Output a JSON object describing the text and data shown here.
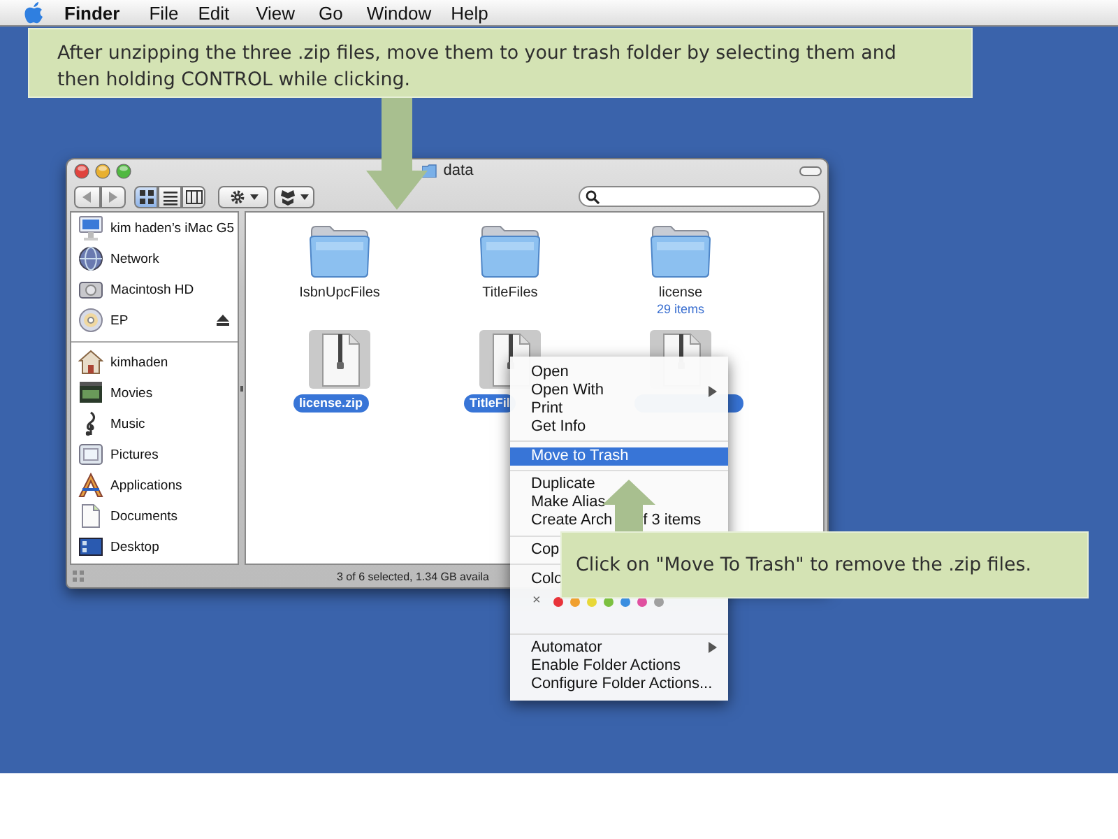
{
  "menubar": {
    "items": [
      {
        "label": "Finder",
        "kind": "app"
      },
      {
        "label": "File",
        "kind": "menu"
      },
      {
        "label": "Edit",
        "kind": "menu"
      },
      {
        "label": "View",
        "kind": "menu"
      },
      {
        "label": "Go",
        "kind": "menu"
      },
      {
        "label": "Window",
        "kind": "menu"
      },
      {
        "label": "Help",
        "kind": "menu"
      }
    ]
  },
  "instruction_top": {
    "text": "After unzipping the three .zip files, move them to your trash folder by selecting them and then holding CONTROL while clicking."
  },
  "window": {
    "title": "data",
    "view_modes": [
      {
        "kind": "icon",
        "selected": true
      },
      {
        "kind": "list",
        "selected": false
      },
      {
        "kind": "columns",
        "selected": false
      }
    ],
    "sidebar": {
      "devices": [
        {
          "label": "kim haden’s iMac G5",
          "ejectable": false
        },
        {
          "label": "Network",
          "ejectable": false
        },
        {
          "label": "Macintosh HD",
          "ejectable": false
        },
        {
          "label": "EP",
          "ejectable": true
        }
      ],
      "places": [
        {
          "label": "kimhaden"
        },
        {
          "label": "Movies"
        },
        {
          "label": "Music"
        },
        {
          "label": "Pictures"
        },
        {
          "label": "Applications"
        },
        {
          "label": "Documents"
        },
        {
          "label": "Desktop"
        }
      ]
    },
    "files": [
      {
        "kind": "folder",
        "name": "IsbnUpcFiles",
        "selected": false
      },
      {
        "kind": "folder",
        "name": "TitleFiles",
        "selected": false
      },
      {
        "kind": "folder",
        "name": "license",
        "subtitle": "29 items",
        "selected": false
      },
      {
        "kind": "zip",
        "name": "license.zip",
        "selected": true
      },
      {
        "kind": "zip",
        "name": "TitleFil",
        "selected": true
      },
      {
        "kind": "zip",
        "selected": true
      }
    ],
    "status": "3 of 6 selected, 1.34 GB availa"
  },
  "context_menu": {
    "items": [
      {
        "kind": "item",
        "text": "Open",
        "selected": false
      },
      {
        "kind": "item",
        "text": "Open With",
        "submenu": true,
        "selected": false
      },
      {
        "kind": "item",
        "text": "Print",
        "selected": false
      },
      {
        "kind": "item",
        "text": "Get Info",
        "selected": false
      },
      {
        "kind": "separator"
      },
      {
        "kind": "item",
        "text": "Move to Trash",
        "selected": true
      },
      {
        "kind": "separator"
      },
      {
        "kind": "item",
        "text": "Duplicate",
        "selected": false
      },
      {
        "kind": "item",
        "text": "Make Alias",
        "selected": false
      },
      {
        "kind": "item",
        "text": "Create Arch",
        "text_after_gap": "f 3 items",
        "selected": false
      },
      {
        "kind": "separator"
      },
      {
        "kind": "item",
        "text": "Cop",
        "selected": false
      },
      {
        "kind": "separator"
      },
      {
        "kind": "item",
        "text": "Colo",
        "selected": false
      },
      {
        "kind": "colors",
        "none_label": "×",
        "colors": [
          {
            "color": "#e8333a"
          },
          {
            "color": "#f0a030"
          },
          {
            "color": "#e8d838"
          },
          {
            "color": "#7cc040"
          },
          {
            "color": "#3a8ee0"
          },
          {
            "color": "#e050a0"
          },
          {
            "color": "#a0a0a0"
          }
        ]
      },
      {
        "kind": "separator"
      },
      {
        "kind": "item",
        "text": "Automator",
        "submenu": true,
        "selected": false
      },
      {
        "kind": "item",
        "text": "Enable Folder Actions",
        "selected": false
      },
      {
        "kind": "item",
        "text": "Configure Folder Actions...",
        "selected": false
      }
    ]
  },
  "instruction_bottom": {
    "text": "Click on \"Move To Trash\" to remove the .zip files."
  }
}
